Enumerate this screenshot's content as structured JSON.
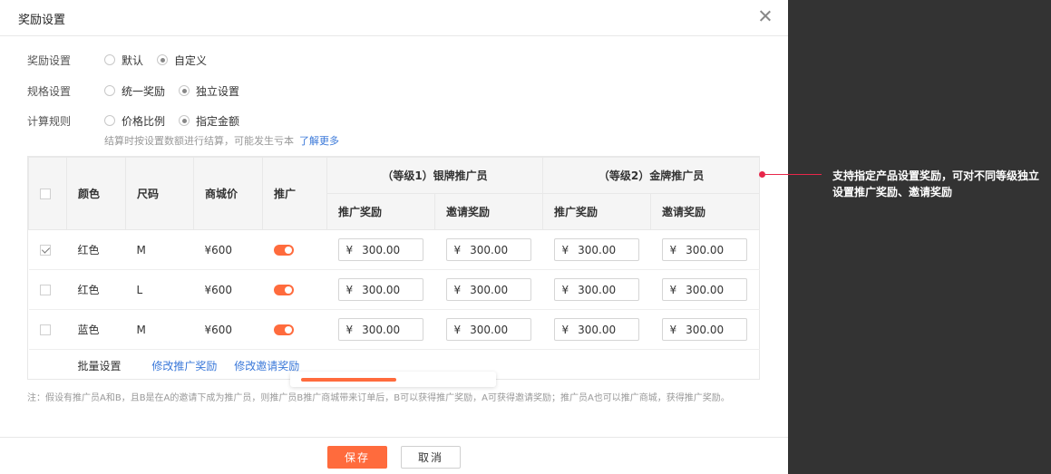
{
  "dialog": {
    "title": "奖励设置",
    "reward_setting": {
      "label": "奖励设置",
      "options": [
        "默认",
        "自定义"
      ],
      "selected": 1
    },
    "spec_setting": {
      "label": "规格设置",
      "options": [
        "统一奖励",
        "独立设置"
      ],
      "selected": 1
    },
    "calc_rule": {
      "label": "计算规则",
      "options": [
        "价格比例",
        "指定金额"
      ],
      "selected": 1
    },
    "hint": "结算时按设置数额进行结算，可能发生亏本",
    "learn_more": "了解更多"
  },
  "table": {
    "headers": {
      "color": "颜色",
      "size": "尺码",
      "price": "商城价",
      "promote": "推广",
      "level1": "（等级1）银牌推广员",
      "level2": "（等级2）金牌推广员",
      "promo_reward": "推广奖励",
      "invite_reward": "邀请奖励"
    },
    "rows": [
      {
        "checked": true,
        "color": "红色",
        "size": "M",
        "price": "¥600",
        "promote_on": true,
        "l1_promo": "300.00",
        "l1_invite": "300.00",
        "l2_promo": "300.00",
        "l2_invite": "300.00"
      },
      {
        "checked": false,
        "color": "红色",
        "size": "L",
        "price": "¥600",
        "promote_on": true,
        "l1_promo": "300.00",
        "l1_invite": "300.00",
        "l2_promo": "300.00",
        "l2_invite": "300.00"
      },
      {
        "checked": false,
        "color": "蓝色",
        "size": "M",
        "price": "¥600",
        "promote_on": true,
        "l1_promo": "300.00",
        "l1_invite": "300.00",
        "l2_promo": "300.00",
        "l2_invite": "300.00"
      }
    ],
    "currency": "¥",
    "batch": {
      "label": "批量设置",
      "edit_promo": "修改推广奖励",
      "edit_invite": "修改邀请奖励"
    }
  },
  "note": "注：假设有推广员A和B，且B是在A的邀请下成为推广员，则推广员B推广商城带来订单后，B可以获得推广奖励，A可获得邀请奖励；推广员A也可以推广商城，获得推广奖励。",
  "footer": {
    "save": "保存",
    "cancel": "取消"
  },
  "annotation": "支持指定产品设置奖励，可对不同等级独立设置推广奖励、邀请奖励",
  "colors": {
    "accent": "#ff6b3d",
    "link": "#3a78d9",
    "annotation": "#e8274a",
    "backdrop": "#333333"
  }
}
